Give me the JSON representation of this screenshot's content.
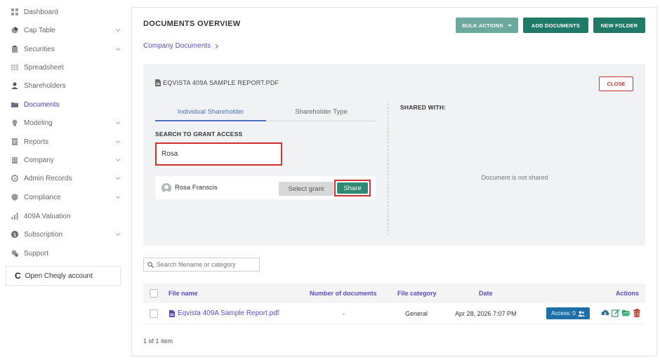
{
  "sidebar": {
    "items": [
      {
        "label": "Dashboard",
        "icon": "dashboard-icon",
        "chevron": false,
        "active": false
      },
      {
        "label": "Cap Table",
        "icon": "pie-chart-icon",
        "chevron": true,
        "active": false
      },
      {
        "label": "Securities",
        "icon": "clipboard-icon",
        "chevron": true,
        "active": false
      },
      {
        "label": "Spreadsheet",
        "icon": "grid-icon",
        "chevron": false,
        "active": false
      },
      {
        "label": "Shareholders",
        "icon": "user-icon",
        "chevron": false,
        "active": false
      },
      {
        "label": "Documents",
        "icon": "folder-icon",
        "chevron": false,
        "active": true
      },
      {
        "label": "Modeling",
        "icon": "lightbulb-icon",
        "chevron": true,
        "active": false
      },
      {
        "label": "Reports",
        "icon": "report-icon",
        "chevron": true,
        "active": false
      },
      {
        "label": "Company",
        "icon": "building-icon",
        "chevron": true,
        "active": false
      },
      {
        "label": "Admin Records",
        "icon": "admin-icon",
        "chevron": true,
        "active": false
      },
      {
        "label": "Compliance",
        "icon": "shield-icon",
        "chevron": true,
        "active": false
      },
      {
        "label": "409A Valuation",
        "icon": "bar-chart-icon",
        "chevron": false,
        "active": false
      },
      {
        "label": "Subscription",
        "icon": "dollar-icon",
        "chevron": true,
        "active": false
      },
      {
        "label": "Support",
        "icon": "support-icon",
        "chevron": false,
        "active": false
      }
    ],
    "open_account_label": "Open Cheqly account"
  },
  "header": {
    "title": "DOCUMENTS OVERVIEW",
    "bulk_actions_label": "BULK ACTIONS",
    "add_documents_label": "ADD DOCUMENTS",
    "new_folder_label": "NEW FOLDER",
    "breadcrumb": "Company Documents"
  },
  "detail": {
    "file_title": "EQVISTA 409A SAMPLE REPORT.PDF",
    "close_label": "CLOSE",
    "tabs": [
      {
        "label": "Individual Shareholder",
        "active": true
      },
      {
        "label": "Shareholder Type",
        "active": false
      }
    ],
    "search_label": "SEARCH TO GRANT ACCESS",
    "search_value": "Rosa",
    "result": {
      "name": "Rosa Franscis",
      "select_grant_label": "Select grant",
      "share_label": "Share"
    },
    "shared_with_label": "SHARED WITH:",
    "not_shared_text": "Document is not shared"
  },
  "files": {
    "search_placeholder": "Search filename or category",
    "columns": {
      "file_name": "File name",
      "num_docs": "Number of documents",
      "category": "File category",
      "date": "Date",
      "actions": "Actions"
    },
    "rows": [
      {
        "name": "Eqvista 409A Sample Report.pdf",
        "num_docs": "-",
        "category": "General",
        "date": "Apr 28, 2026 7:07 PM",
        "access_label": "Access: 0"
      }
    ],
    "pager": "1 of 1 item"
  },
  "colors": {
    "brand_green": "#1f7a68",
    "brand_green_light": "#6aa99c",
    "link_purple": "#5a4bbf",
    "tab_blue": "#4a6fc0",
    "highlight_red": "#d32f2f",
    "access_blue": "#1e6fa8"
  }
}
